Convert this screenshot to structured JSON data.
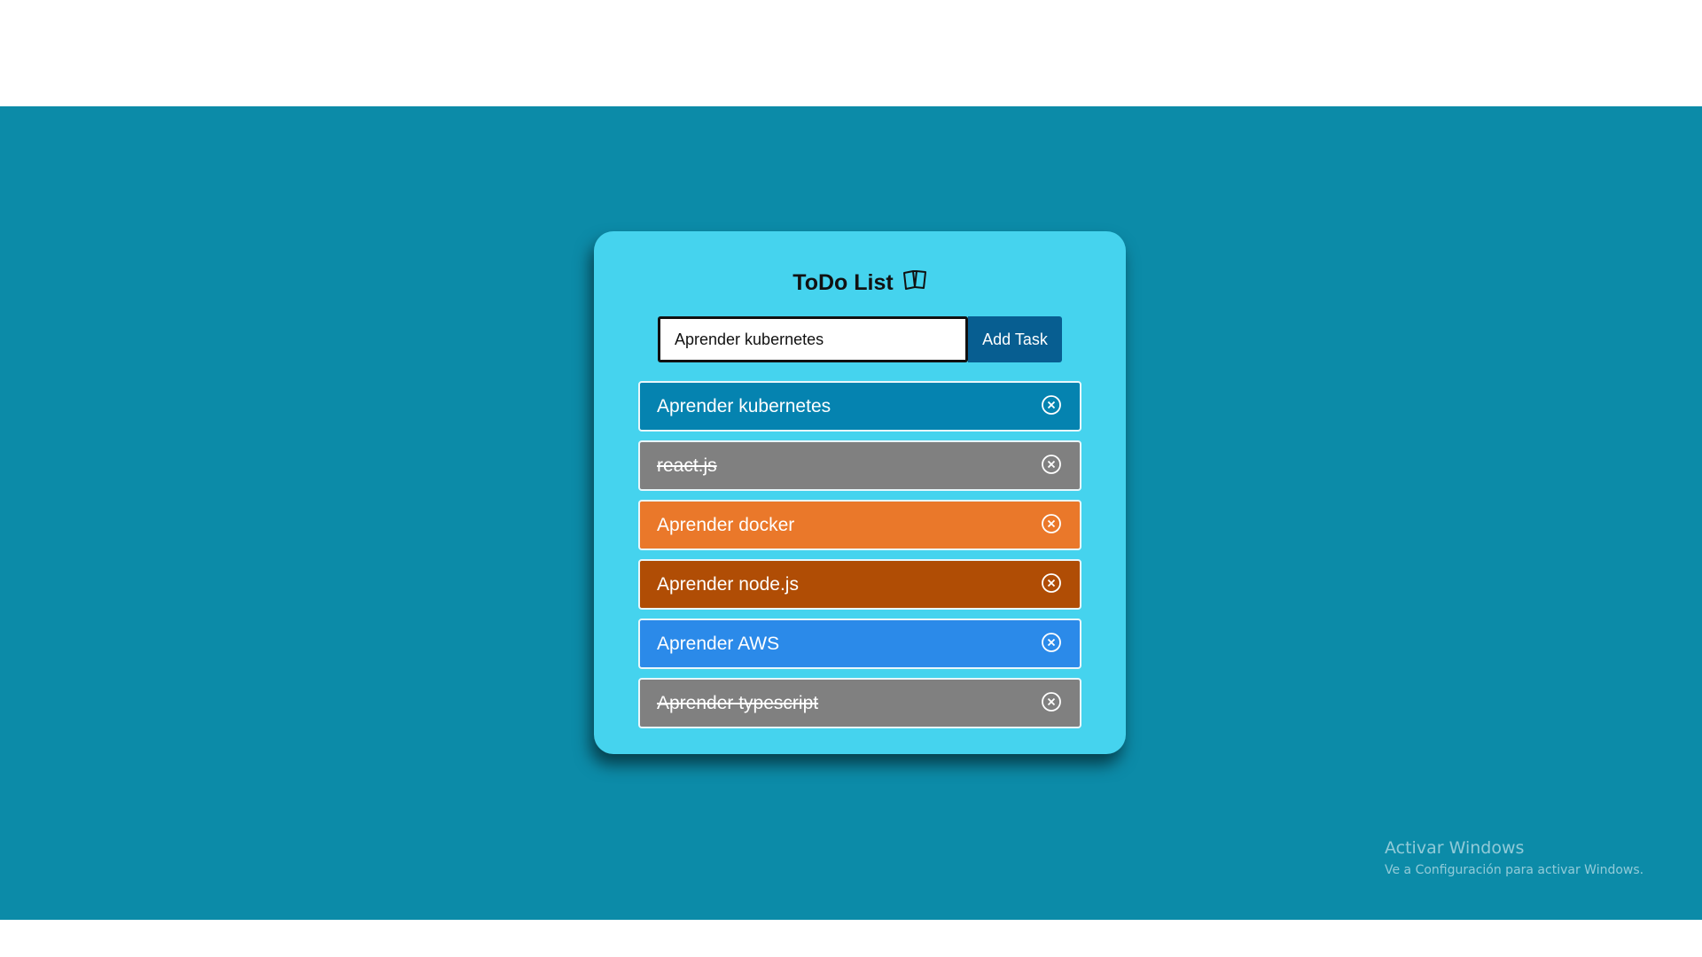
{
  "app": {
    "title": "ToDo List",
    "title_icon": "book-icon"
  },
  "form": {
    "input_value": "Aprender kubernetes",
    "add_label": "Add Task"
  },
  "tasks": [
    {
      "text": "Aprender kubernetes",
      "color": "#0583b0",
      "done": false
    },
    {
      "text": "react.js",
      "color": "#808080",
      "done": true
    },
    {
      "text": "Aprender docker",
      "color": "#ea782a",
      "done": false
    },
    {
      "text": "Aprender node.js",
      "color": "#b04d05",
      "done": false
    },
    {
      "text": "Aprender AWS",
      "color": "#2b8ae9",
      "done": false
    },
    {
      "text": "Aprender typescript",
      "color": "#808080",
      "done": true
    }
  ],
  "remove_icon": "close-circle-icon",
  "watermark": {
    "line1": "Activar Windows",
    "line2": "Ve a Configuración para activar Windows."
  },
  "colors": {
    "background": "#0c8ba8",
    "card": "#45d3ee",
    "button": "#075e91"
  }
}
